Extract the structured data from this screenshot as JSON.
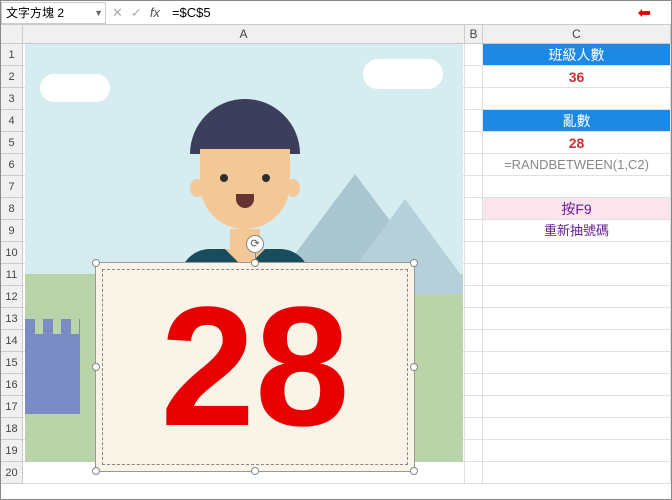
{
  "formula_bar": {
    "name_box": "文字方塊 2",
    "formula": "=$C$5",
    "icons": {
      "cancel": "✕",
      "confirm": "✓",
      "fx": "fx"
    },
    "arrow": "⬅"
  },
  "columns": [
    "A",
    "B",
    "C"
  ],
  "rows": [
    "1",
    "2",
    "3",
    "4",
    "5",
    "6",
    "7",
    "8",
    "9",
    "10",
    "11",
    "12",
    "13",
    "14",
    "15",
    "16",
    "17",
    "18",
    "19",
    "20"
  ],
  "c_column": {
    "header_count": "班級人數",
    "count_value": "36",
    "header_rand": "亂數",
    "rand_value": "28",
    "rand_formula": "=RANDBETWEEN(1,C2)",
    "hint_title": "按F9",
    "hint_sub": "重新抽號碼"
  },
  "textbox": {
    "value": "28"
  }
}
